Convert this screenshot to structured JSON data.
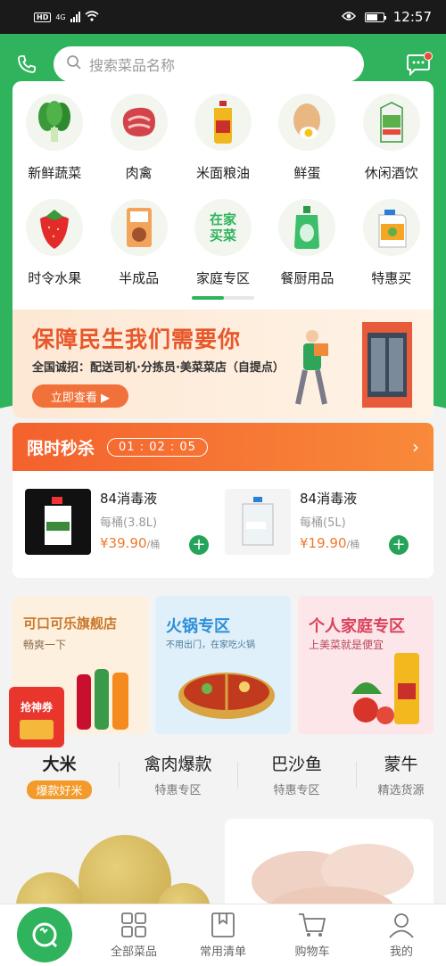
{
  "status_bar": {
    "network": "4G",
    "hd": "HD",
    "time": "12:57",
    "battery_level": 0.7
  },
  "header": {
    "search_placeholder": "搜索菜品名称",
    "left_icon": "phone-icon",
    "right_icon": "message-icon"
  },
  "categories": [
    {
      "label": "新鲜蔬菜",
      "icon": "vegetable-icon"
    },
    {
      "label": "肉禽",
      "icon": "meat-icon"
    },
    {
      "label": "米面粮油",
      "icon": "oil-icon"
    },
    {
      "label": "鲜蛋",
      "icon": "egg-icon"
    },
    {
      "label": "休闲酒饮",
      "icon": "drink-icon"
    },
    {
      "label": "时令水果",
      "icon": "strawberry-icon"
    },
    {
      "label": "半成品",
      "icon": "package-icon"
    },
    {
      "label": "家庭专区",
      "icon": "home-buy-icon",
      "badge": "在家\n买菜"
    },
    {
      "label": "餐厨用品",
      "icon": "detergent-icon"
    },
    {
      "label": "特惠买",
      "icon": "bottle-icon"
    }
  ],
  "banner": {
    "title": "保障民生我们需要你",
    "subtitle": "全国诚招：配送司机·分拣员·美菜菜店（自提点）",
    "button": "立即查看 ▶"
  },
  "flash_sale": {
    "title": "限时秒杀",
    "timer": "01 : 02 : 05",
    "items": [
      {
        "name": "84消毒液",
        "spec": "每桶(3.8L)",
        "price": "¥39.90",
        "unit": "/桶"
      },
      {
        "name": "84消毒液",
        "spec": "每桶(5L)",
        "price": "¥19.90",
        "unit": "/桶"
      }
    ]
  },
  "promos": [
    {
      "title": "可口可乐旗舰店",
      "subtitle": "畅爽一下",
      "color": "#fdf0df",
      "title_color": "#c9772a"
    },
    {
      "title": "火锅专区",
      "subtitle": "不用出门，在家吃火锅",
      "color": "#dff0fb",
      "title_color": "#2d8fd8"
    },
    {
      "title": "个人家庭专区",
      "subtitle": "上美菜就是便宜",
      "color": "#fde6ea",
      "title_color": "#d9425a"
    }
  ],
  "coupon": {
    "label": "抢神券"
  },
  "feature_tabs": [
    {
      "title": "大米",
      "subtitle": "爆款好米"
    },
    {
      "title": "禽肉爆款",
      "subtitle": "特惠专区"
    },
    {
      "title": "巴沙鱼",
      "subtitle": "特惠专区"
    },
    {
      "title": "蒙牛",
      "subtitle": "精选货源"
    }
  ],
  "bottom_nav": [
    {
      "label": "",
      "icon": "home-logo-icon"
    },
    {
      "label": "全部菜品",
      "icon": "grid-icon"
    },
    {
      "label": "常用清单",
      "icon": "bookmark-list-icon"
    },
    {
      "label": "购物车",
      "icon": "cart-icon"
    },
    {
      "label": "我的",
      "icon": "user-icon"
    }
  ],
  "colors": {
    "brand_green": "#2fb35c",
    "flash_orange": "#f4612d",
    "price_orange": "#f07a2a"
  }
}
